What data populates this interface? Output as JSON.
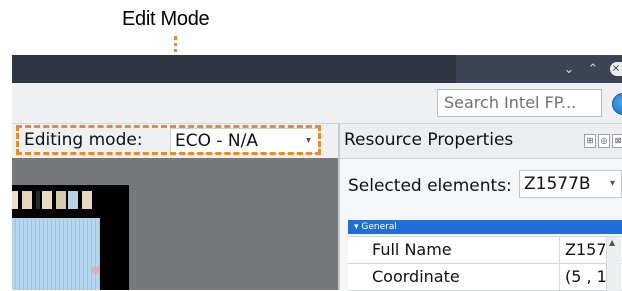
{
  "callout": {
    "title": "Edit Mode",
    "color": "#e98a2b"
  },
  "titlebar": {
    "minimize_icon": "chevron-down-icon",
    "maximize_icon": "chevron-up-icon",
    "close_icon": "close-icon",
    "minimize_glyph": "⌄",
    "maximize_glyph": "⌃",
    "close_glyph": "×"
  },
  "toolbar": {
    "search_placeholder": "Search Intel FP...",
    "globe_icon": "globe-icon"
  },
  "editing": {
    "label": "Editing mode:",
    "value": "ECO - N/A"
  },
  "resource_properties": {
    "title": "Resource Properties",
    "selected_label": "Selected elements:",
    "selected_value": "Z1577B",
    "group": "General",
    "rows": [
      {
        "name": "Full Name",
        "value": "Z157"
      },
      {
        "name": "Coordinate",
        "value": "(5 , 1"
      }
    ]
  },
  "colors": {
    "titlebar": "#2e3440",
    "accent_blue": "#1e6fd9",
    "canvas_gray": "#777879",
    "grid_blue": "#b5d6ee"
  }
}
